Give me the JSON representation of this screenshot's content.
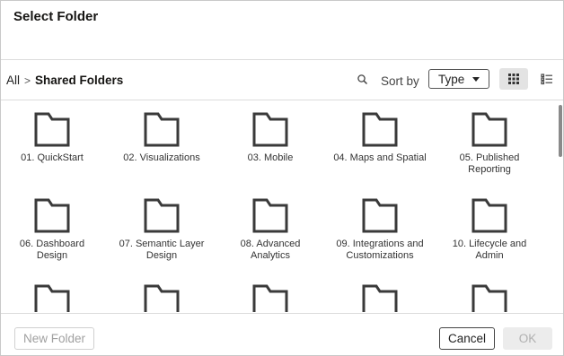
{
  "dialog": {
    "title": "Select Folder"
  },
  "breadcrumb": {
    "root": "All",
    "separator": ">",
    "current": "Shared Folders"
  },
  "toolbar": {
    "search_icon": "search-icon",
    "sort_label": "Sort by",
    "sort_value": "Type",
    "view_grid_icon": "grid-view-icon",
    "view_list_icon": "list-view-icon",
    "active_view": "grid"
  },
  "folders": [
    {
      "line1": "01. QuickStart",
      "line2": ""
    },
    {
      "line1": "02. Visualizations",
      "line2": ""
    },
    {
      "line1": "03. Mobile",
      "line2": ""
    },
    {
      "line1": "04. Maps and Spatial",
      "line2": ""
    },
    {
      "line1": "05. Published",
      "line2": "Reporting"
    },
    {
      "line1": "06. Dashboard",
      "line2": "Design"
    },
    {
      "line1": "07. Semantic Layer",
      "line2": "Design"
    },
    {
      "line1": "08. Advanced",
      "line2": "Analytics"
    },
    {
      "line1": "09. Integrations and",
      "line2": "Customizations"
    },
    {
      "line1": "10. Lifecycle and",
      "line2": "Admin"
    }
  ],
  "footer": {
    "new_folder_label": "New Folder",
    "cancel_label": "Cancel",
    "ok_label": "OK"
  }
}
